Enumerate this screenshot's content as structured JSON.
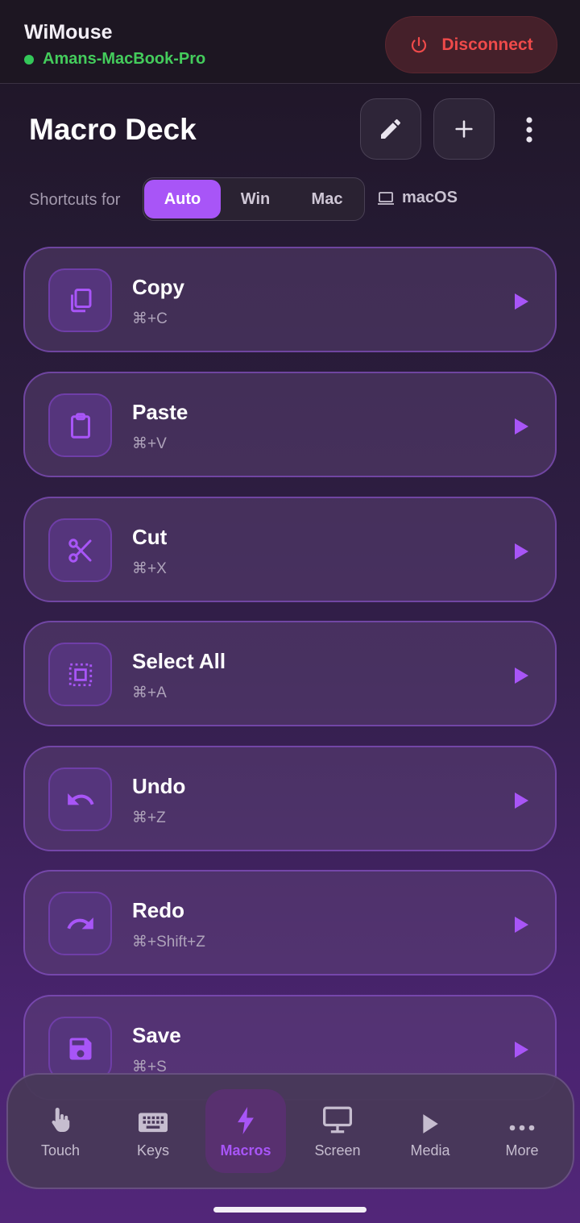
{
  "app": {
    "title": "WiMouse",
    "device_name": "Amans-MacBook-Pro",
    "status_color": "#34c759",
    "disconnect_label": "Disconnect"
  },
  "header": {
    "title": "Macro Deck",
    "edit_icon": "pencil-icon",
    "add_icon": "plus-icon",
    "more_icon": "vertical-dots-icon"
  },
  "shortcuts": {
    "label": "Shortcuts for",
    "options": [
      "Auto",
      "Win",
      "Mac"
    ],
    "selected": "Auto",
    "detected_os": "macOS"
  },
  "macros": [
    {
      "name": "Copy",
      "keys": "⌘+C",
      "icon": "copy-icon"
    },
    {
      "name": "Paste",
      "keys": "⌘+V",
      "icon": "clipboard-icon"
    },
    {
      "name": "Cut",
      "keys": "⌘+X",
      "icon": "scissors-icon"
    },
    {
      "name": "Select All",
      "keys": "⌘+A",
      "icon": "select-all-icon"
    },
    {
      "name": "Undo",
      "keys": "⌘+Z",
      "icon": "undo-icon"
    },
    {
      "name": "Redo",
      "keys": "⌘+Shift+Z",
      "icon": "redo-icon"
    },
    {
      "name": "Save",
      "keys": "⌘+S",
      "icon": "save-icon"
    }
  ],
  "nav": {
    "items": [
      {
        "label": "Touch",
        "icon": "touch-icon"
      },
      {
        "label": "Keys",
        "icon": "keyboard-icon"
      },
      {
        "label": "Macros",
        "icon": "bolt-icon"
      },
      {
        "label": "Screen",
        "icon": "monitor-icon"
      },
      {
        "label": "Media",
        "icon": "play-icon"
      },
      {
        "label": "More",
        "icon": "horizontal-dots-icon"
      }
    ],
    "active": "Macros"
  },
  "colors": {
    "accent": "#a855f7",
    "danger": "#ef4a4a",
    "connected": "#34c759"
  }
}
